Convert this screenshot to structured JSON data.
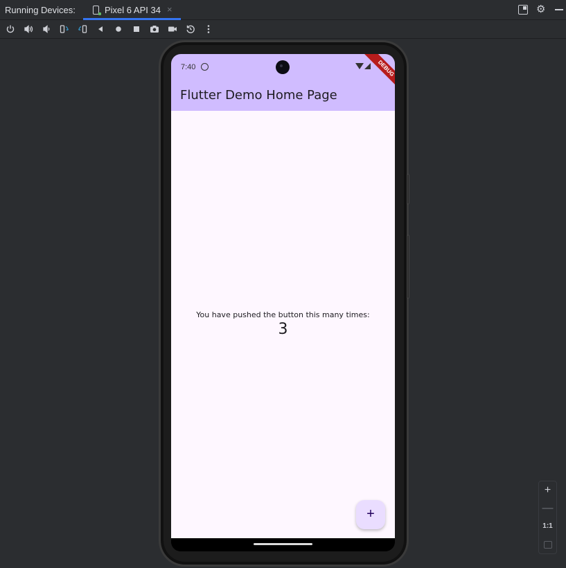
{
  "panel": {
    "title": "Running Devices:"
  },
  "tab": {
    "label": "Pixel 6 API 34",
    "close": "×",
    "icon": "phone-device-icon"
  },
  "window_actions": [
    "layout-icon",
    "gear-icon",
    "minimize-icon"
  ],
  "toolbar": {
    "icons": [
      "power-icon",
      "volume-up-icon",
      "volume-down-icon",
      "rotate-left-icon",
      "rotate-right-icon",
      "back-icon",
      "home-icon",
      "overview-icon",
      "screenshot-icon",
      "screen-record-icon",
      "reset-icon",
      "more-icon"
    ]
  },
  "device": {
    "status": {
      "time": "7:40"
    },
    "debug_banner": "DEBUG",
    "app_title": "Flutter Demo Home Page",
    "message": "You have pushed the button this many times:",
    "counter": "3",
    "fab_label": "+"
  },
  "zoom": {
    "zoom_in": "+",
    "zoom_out": "—",
    "actual_size": "1:1"
  },
  "colors": {
    "ide_bg": "#2b2d30",
    "accent": "#3574f0",
    "appbar": "#d0bcff",
    "app_body": "#fef7ff",
    "fab": "#eaddff",
    "debug": "#b71c1c"
  }
}
